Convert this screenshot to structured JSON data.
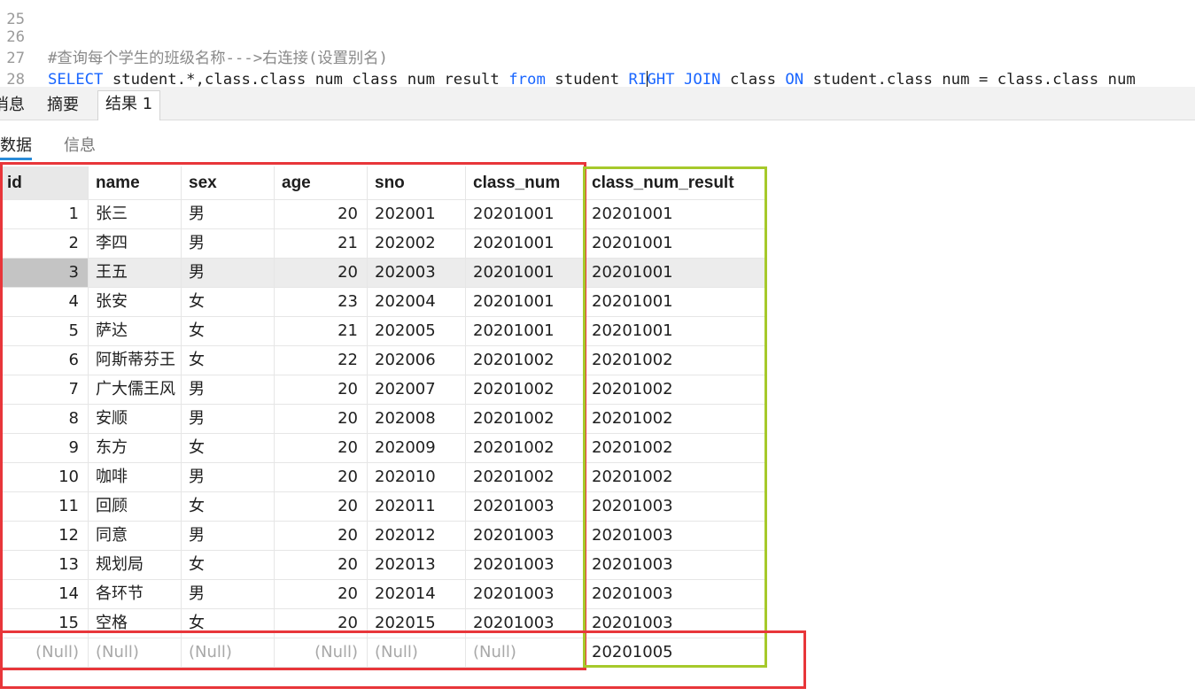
{
  "editor": {
    "lines": [
      {
        "number": "26",
        "comment": "#查询每个学生的班级名称--->右连接(设置别名)"
      },
      {
        "number": "27",
        "segments": [
          {
            "t": "SELECT",
            "k": "kw"
          },
          {
            "t": " student.*,class.class_num class_num_result ",
            "k": "pl"
          },
          {
            "t": "from",
            "k": "kw"
          },
          {
            "t": " student ",
            "k": "pl"
          },
          {
            "t": "RIGHT",
            "k": "kw",
            "caret_after": 2
          },
          {
            "t": " ",
            "k": "pl"
          },
          {
            "t": "JOIN",
            "k": "kw"
          },
          {
            "t": " class ",
            "k": "pl"
          },
          {
            "t": "ON",
            "k": "kw"
          },
          {
            "t": " student.class_num = class.class_num",
            "k": "pl"
          }
        ]
      },
      {
        "number": "28",
        "comment": ""
      }
    ]
  },
  "tabs": [
    {
      "label": "消息",
      "active": false
    },
    {
      "label": "摘要",
      "active": false
    },
    {
      "label": "结果 1",
      "active": true
    }
  ],
  "subtabs": [
    {
      "label": "数据",
      "active": true
    },
    {
      "label": "信息",
      "active": false
    }
  ],
  "table": {
    "columns": [
      "id",
      "name",
      "sex",
      "age",
      "sno",
      "class_num",
      "class_num_result"
    ],
    "numeric_columns": [
      0,
      3
    ],
    "selected_row": 2,
    "rows": [
      [
        "1",
        "张三",
        "男",
        "20",
        "202001",
        "20201001",
        "20201001"
      ],
      [
        "2",
        "李四",
        "男",
        "21",
        "202002",
        "20201001",
        "20201001"
      ],
      [
        "3",
        "王五",
        "男",
        "20",
        "202003",
        "20201001",
        "20201001"
      ],
      [
        "4",
        "张安",
        "女",
        "23",
        "202004",
        "20201001",
        "20201001"
      ],
      [
        "5",
        "萨达",
        "女",
        "21",
        "202005",
        "20201001",
        "20201001"
      ],
      [
        "6",
        "阿斯蒂芬王",
        "女",
        "22",
        "202006",
        "20201002",
        "20201002"
      ],
      [
        "7",
        "广大儒王风",
        "男",
        "20",
        "202007",
        "20201002",
        "20201002"
      ],
      [
        "8",
        "安顺",
        "男",
        "20",
        "202008",
        "20201002",
        "20201002"
      ],
      [
        "9",
        "东方",
        "女",
        "20",
        "202009",
        "20201002",
        "20201002"
      ],
      [
        "10",
        "咖啡",
        "男",
        "20",
        "202010",
        "20201002",
        "20201002"
      ],
      [
        "11",
        "回顾",
        "女",
        "20",
        "202011",
        "20201003",
        "20201003"
      ],
      [
        "12",
        "同意",
        "男",
        "20",
        "202012",
        "20201003",
        "20201003"
      ],
      [
        "13",
        "规划局",
        "女",
        "20",
        "202013",
        "20201003",
        "20201003"
      ],
      [
        "14",
        "各环节",
        "男",
        "20",
        "202014",
        "20201003",
        "20201003"
      ],
      [
        "15",
        "空格",
        "女",
        "20",
        "202015",
        "20201003",
        "20201003"
      ],
      [
        "(Null)",
        "(Null)",
        "(Null)",
        "(Null)",
        "(Null)",
        "(Null)",
        "20201005"
      ]
    ]
  },
  "annotation_colors": {
    "red": "#e8363a",
    "green": "#a6c92b"
  }
}
